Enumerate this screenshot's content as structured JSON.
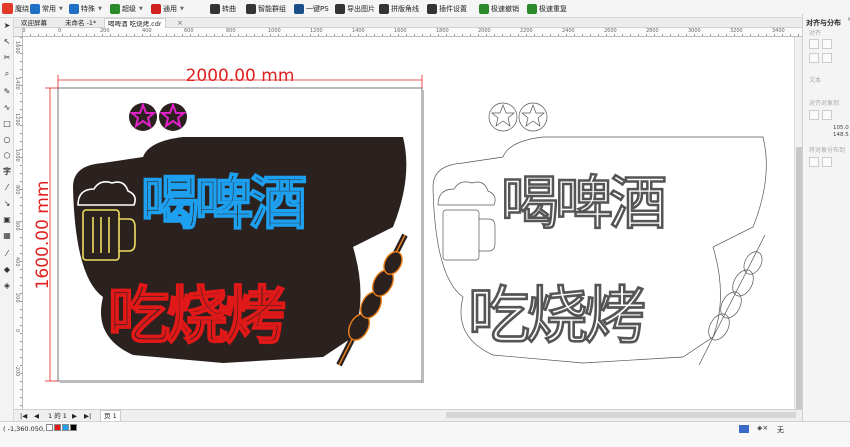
{
  "window": {
    "title": "魔绕"
  },
  "toolbar": {
    "items": [
      {
        "label": "常用",
        "icon": "common-icon",
        "color": "#1f6fc5",
        "dropdown": true
      },
      {
        "label": "特殊",
        "icon": "special-icon",
        "color": "#1f6fc5",
        "dropdown": true
      },
      {
        "label": "超级",
        "icon": "super-icon",
        "color": "#2a8a2a",
        "dropdown": true
      },
      {
        "label": "通用",
        "icon": "general-icon",
        "color": "#d02020",
        "dropdown": true
      },
      {
        "label": "转曲",
        "icon": "curve-icon",
        "color": "#333333",
        "dropdown": false
      },
      {
        "label": "智能群组",
        "icon": "smart-group-icon",
        "color": "#333333",
        "dropdown": false
      },
      {
        "label": "一键PS",
        "icon": "ps-icon",
        "color": "#1a4f8a",
        "dropdown": false
      },
      {
        "label": "导出图片",
        "icon": "export-image-icon",
        "color": "#333333",
        "dropdown": false
      },
      {
        "label": "拼版角线",
        "icon": "crop-mark-icon",
        "color": "#333333",
        "dropdown": false
      },
      {
        "label": "插件设置",
        "icon": "settings-icon",
        "color": "#333333",
        "dropdown": false
      },
      {
        "label": "极速撤销",
        "icon": "undo-icon",
        "color": "#2a8a2a",
        "dropdown": false
      },
      {
        "label": "极速重复",
        "icon": "redo-icon",
        "color": "#2a8a2a",
        "dropdown": false
      }
    ]
  },
  "tabs": [
    {
      "label": "欢迎屏幕",
      "active": false
    },
    {
      "label": "未命名 -1*",
      "active": false
    },
    {
      "label": "喝啤酒 吃烧烤.cdr",
      "active": true
    }
  ],
  "ruler": {
    "h_labels": [
      "200",
      "0",
      "200",
      "400",
      "600",
      "800",
      "1000",
      "1200",
      "1400",
      "1600",
      "1800",
      "2000",
      "2200",
      "2400",
      "2600",
      "2800",
      "3000",
      "3200",
      "3400"
    ],
    "v_labels": [
      "1600",
      "1400",
      "1200",
      "1000",
      "800",
      "600",
      "400",
      "200",
      "0",
      "-200"
    ]
  },
  "artwork": {
    "width_dim": "2000.00 mm",
    "height_dim": "1600.00 mm",
    "title_line1": "喝啤酒",
    "title_line2": "吃烧烤",
    "outline_line1": "喝啤酒",
    "outline_line2": "吃烧烤",
    "colors": {
      "beer_text": "#1ea0f0",
      "bbq_text": "#e01818",
      "stars": "#e020c8",
      "mug": "#f0e060",
      "skewer": "#f08018",
      "dim": "#e02020"
    }
  },
  "pagebar": {
    "page_info": "1 的 1",
    "page_tab": "页 1"
  },
  "status": {
    "coords": "( -1,360.050, -401.6...",
    "fill_label": "无"
  },
  "panel": {
    "title": "对齐与分布",
    "section1": "对齐",
    "section2": "文本",
    "section3": "对齐对象到",
    "section4": "将对象分布到",
    "val_x": "105.0",
    "val_y": "148.5"
  }
}
